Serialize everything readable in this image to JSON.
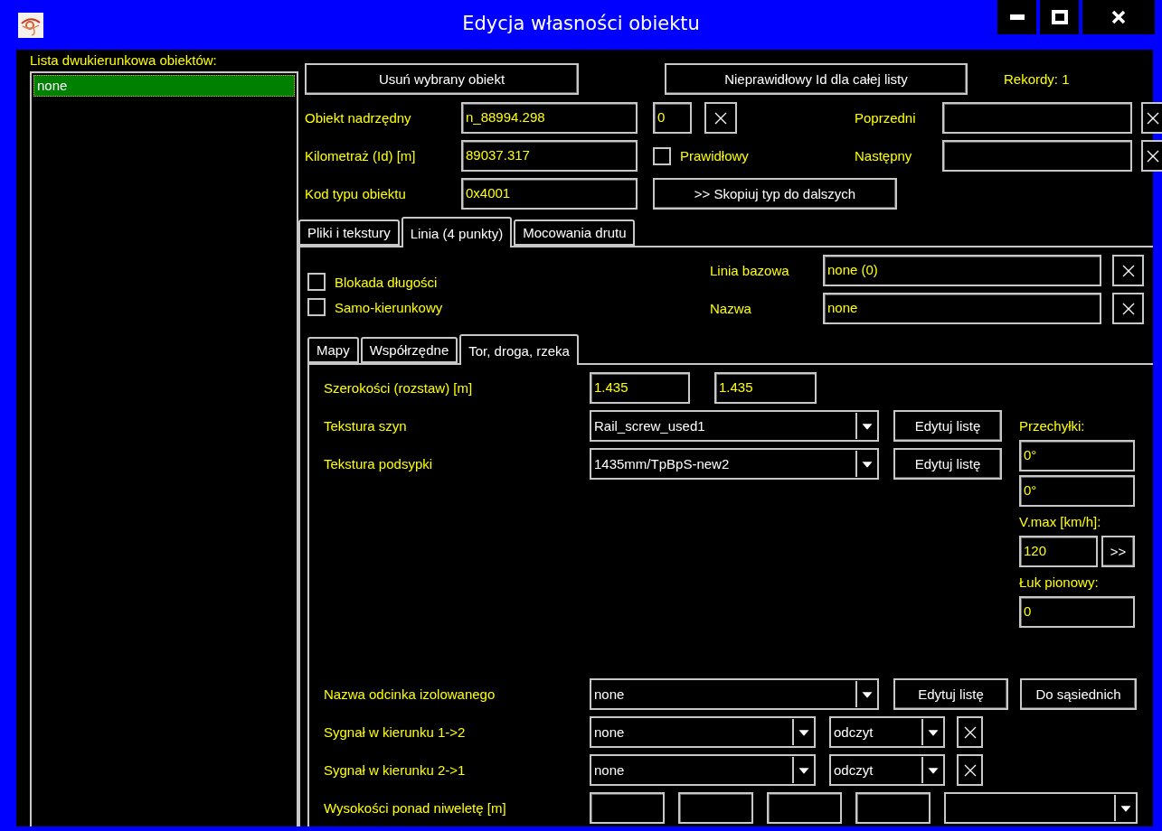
{
  "window": {
    "title": "Edycja własności obiektu"
  },
  "object_list": {
    "label": "Lista dwukierunkowa obiektów:",
    "items": [
      {
        "text": "none",
        "selected": true
      }
    ]
  },
  "toolbar": {
    "buttons": [
      "Usuń wybrany obiekt",
      "Nieprawidłowy Id dla całej listy"
    ],
    "records": "Rekordy: 1"
  },
  "parent": {
    "label": "Obiekt nadrzędny",
    "value": "n_88994.298",
    "index": "0"
  },
  "mileage": {
    "label": "Kilometraż (Id) [m]",
    "value": "89037.317"
  },
  "valid": {
    "label": "Prawidłowy",
    "checked": false
  },
  "type_code": {
    "label": "Kod typu obiektu",
    "value": "0x4001"
  },
  "copy_type_button": ">> Skopiuj typ do dalszych",
  "previous": {
    "label": "Poprzedni"
  },
  "next": {
    "label": "Następny"
  },
  "tabs": [
    {
      "label": "Pliki i tekstury",
      "selected": false
    },
    {
      "label": "Linia (4 punkty)",
      "selected": true
    },
    {
      "label": "Mocowania drutu",
      "selected": false
    }
  ],
  "line_tab": {
    "options": [
      {
        "label": "Blokada długości",
        "checked": false
      },
      {
        "label": "Samo-kierunkowy",
        "checked": false
      }
    ],
    "base_line": {
      "label": "Linia bazowa",
      "value": "none (0)"
    },
    "name": {
      "label": "Nazwa",
      "value": "none"
    },
    "subtabs": [
      {
        "label": "Mapy",
        "selected": false
      },
      {
        "label": "Współrzędne",
        "selected": false
      },
      {
        "label": "Tor, droga, rzeka",
        "selected": true
      }
    ],
    "track": {
      "widths": {
        "label": "Szerokości (rozstaw) [m]",
        "values": [
          "1.435",
          "1.435"
        ]
      },
      "rail_texture": {
        "label": "Tekstura szyn",
        "value": "Rail_screw_used1",
        "button": "Edytuj listę"
      },
      "ballast_texture": {
        "label": "Tekstura podsypki",
        "value": "1435mm/TpBpS-new2",
        "button": "Edytuj listę"
      },
      "cant": {
        "label": "Przechyłki:",
        "values": [
          "0°",
          "0°"
        ]
      },
      "vmax": {
        "label": "V.max [km/h]:",
        "value": "120",
        "button": ">>"
      },
      "vertical_arc": {
        "label": "Łuk pionowy:",
        "value": "0"
      },
      "isolated_section": {
        "label": "Nazwa odcinka izolowanego",
        "value": "none",
        "buttons": [
          "Edytuj listę",
          "Do sąsiednich"
        ]
      },
      "signals": [
        {
          "label": "Sygnał w kierunku 1->2",
          "value": "none",
          "mode": "odczyt"
        },
        {
          "label": "Sygnał w kierunku 2->1",
          "value": "none",
          "mode": "odczyt"
        }
      ],
      "heights": {
        "label": "Wysokości ponad niweletę [m]"
      }
    }
  }
}
